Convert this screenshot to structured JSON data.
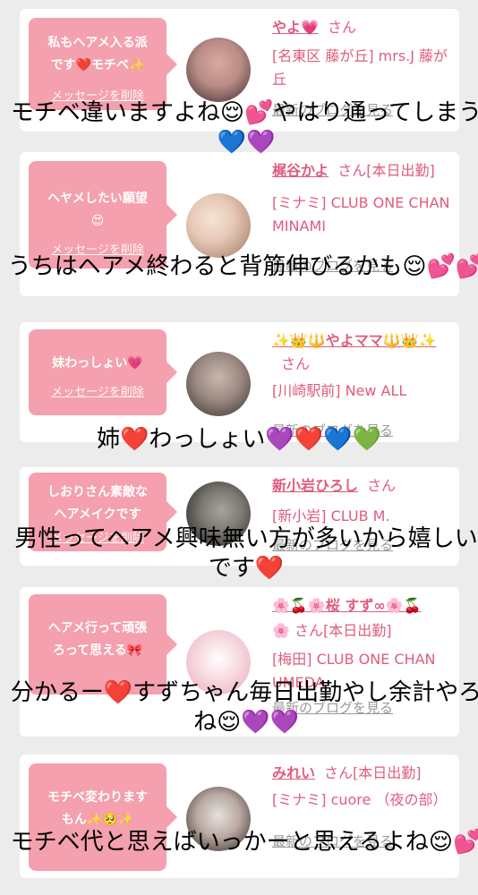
{
  "cards": [
    {
      "bubble": "私もヘアメ入る派\nです❤️モチベ✨",
      "delete": "メッセージを削除",
      "name": "やよ💗",
      "suffix": "さん",
      "shop": "[名東区 藤が丘] mrs.J 藤が丘",
      "blog": "最新のブログを見る"
    },
    {
      "bubble": "ヘヤメしたい願望\n😍",
      "delete": "メッセージを削除",
      "name": "梶谷かよ",
      "suffix": "さん[本日出勤]",
      "shop": "[ミナミ] CLUB ONE CHAN MINAMI",
      "blog": "最新のブログを見る"
    },
    {
      "bubble": "妹わっしょい💗",
      "delete": "メッセージを削除",
      "name": "✨👑🔱やよママ🔱👑✨",
      "suffix": "さん",
      "shop": "[川崎駅前] New ALL",
      "blog": "最新のブログを見る"
    },
    {
      "bubble": "しおりさん素敵な\nヘアメイクです",
      "delete": "メッセージを削除",
      "name": "新小岩ひろし",
      "suffix": "さん",
      "shop": "[新小岩] CLUB M.",
      "blog": "最新のブログを見る"
    },
    {
      "bubble": "ヘアメ行って頑張\nろって思える🎀",
      "delete": "メッセージを削除",
      "name": "🌸🍒🌸桜 すず∞🌸🍒",
      "suffix": "🌸 さん[本日出勤]",
      "shop": "[梅田] CLUB ONE CHAN UMEDA",
      "blog": "最新のブログを見る"
    },
    {
      "bubble": "モチベ変わります\nもん✨🥺✨",
      "delete": "メッセージを削除",
      "name": "みれい",
      "suffix": "さん[本日出勤]",
      "shop": "[ミナミ] cuore （夜の部）",
      "blog": "最新のブログを見る"
    }
  ],
  "overlays": [
    "モチベ違いますよね😌💕やはり通ってしまう💙💜",
    "うちはヘアメ終わると背筋伸びるかも😌💕💕",
    "姉❤️わっしょい💜❤️💙💚",
    "男性ってヘアメ興味無い方が多いから嬉しいです❤️",
    "分かるー❤️すずちゃん毎日出勤やし余計やろね😌💜💜",
    "モチベ代と思えばいっかーと思えるよね😌💕"
  ],
  "avatar_colors": [
    [
      "#b98c86",
      "#3b2a2a"
    ],
    [
      "#e7c9b6",
      "#9c7662"
    ],
    [
      "#9b8a82",
      "#3a2f2c"
    ],
    [
      "#7e7a74",
      "#1e1e1e"
    ],
    [
      "#f7d9df",
      "#e7aab8"
    ],
    [
      "#e5e1de",
      "#2a1f1d"
    ]
  ]
}
